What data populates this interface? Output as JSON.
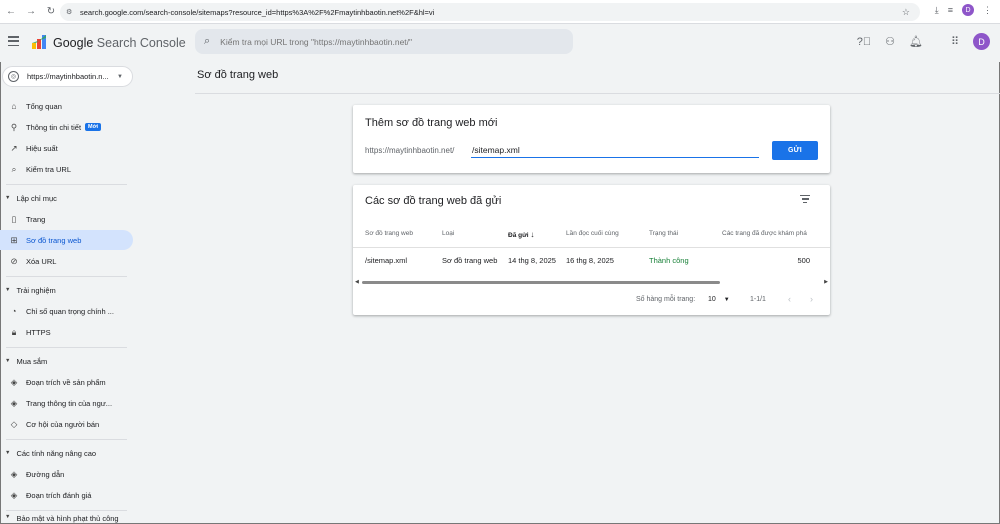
{
  "browser": {
    "url": "search.google.com/search-console/sitemaps?resource_id=https%3A%2F%2Fmaytinhbaotin.net%2F&hl=vi",
    "avatar_letter": "D"
  },
  "header": {
    "title_prefix": "Google",
    "title_suffix": "Search Console",
    "search_placeholder": "Kiểm tra mọi URL trong \"https://maytinhbaotin.net/\"",
    "avatar_letter": "D"
  },
  "sidebar": {
    "property": "https://maytinhbaotin.n...",
    "items": [
      {
        "label": "Tổng quan",
        "icon": "home-icon"
      },
      {
        "label": "Thông tin chi tiết",
        "icon": "lightbulb-icon",
        "badge": "Mới"
      },
      {
        "label": "Hiệu suất",
        "icon": "trending-up-icon"
      },
      {
        "label": "Kiểm tra URL",
        "icon": "search-icon"
      }
    ],
    "sections": [
      {
        "label": "Lập chỉ mục",
        "items": [
          {
            "label": "Trang",
            "icon": "pages-icon"
          },
          {
            "label": "Sơ đồ trang web",
            "icon": "sitemap-icon",
            "active": true
          },
          {
            "label": "Xóa URL",
            "icon": "visibility-off-icon"
          }
        ]
      },
      {
        "label": "Trải nghiệm",
        "items": [
          {
            "label": "Chỉ số quan trọng chính ...",
            "icon": "speed-icon"
          },
          {
            "label": "HTTPS",
            "icon": "lock-icon"
          }
        ]
      },
      {
        "label": "Mua sắm",
        "items": [
          {
            "label": "Đoạn trích về sản phẩm",
            "icon": "layers-icon"
          },
          {
            "label": "Trang thông tin của ngư...",
            "icon": "layers-icon"
          },
          {
            "label": "Cơ hội của người bán",
            "icon": "tag-icon"
          }
        ]
      },
      {
        "label": "Các tính năng nâng cao",
        "items": [
          {
            "label": "Đường dẫn",
            "icon": "layers-icon"
          },
          {
            "label": "Đoạn trích đánh giá",
            "icon": "layers-icon"
          }
        ]
      },
      {
        "label": "Bảo mật và hình phạt thủ công"
      }
    ]
  },
  "main": {
    "page_title": "Sơ đồ trang web",
    "add_card": {
      "title": "Thêm sơ đồ trang web mới",
      "prefix": "https://maytinhbaotin.net/",
      "input_value": "/sitemap.xml",
      "submit_label": "GỬI"
    },
    "submitted_card": {
      "title": "Các sơ đồ trang web đã gửi",
      "columns": [
        "Sơ đồ trang web",
        "Loại",
        "Đã gửi",
        "Lần đọc cuối cùng",
        "Trạng thái",
        "Các trang đã được khám phá"
      ],
      "rows": [
        {
          "sitemap": "/sitemap.xml",
          "type": "Sơ đồ trang web",
          "submitted": "14 thg 8, 2025",
          "last_read": "16 thg 8, 2025",
          "status": "Thành công",
          "discovered": "500"
        }
      ],
      "pager": {
        "rows_per_page_label": "Số hàng mỗi trang:",
        "rows_per_page": "10",
        "range": "1-1/1"
      }
    }
  },
  "colors": {
    "accent": "#1a73e8",
    "success": "#188038",
    "active_bg": "#d3e3fd"
  }
}
